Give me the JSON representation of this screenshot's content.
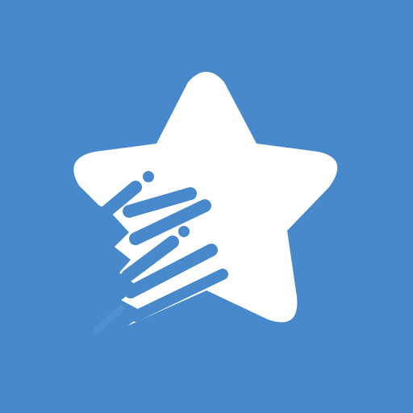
{
  "app_icon": {
    "icon_name": "shooting-star-icon",
    "colors": {
      "background": "#4889CB",
      "star": "#FFFFFF",
      "speed_lines": "#4889CB"
    }
  }
}
